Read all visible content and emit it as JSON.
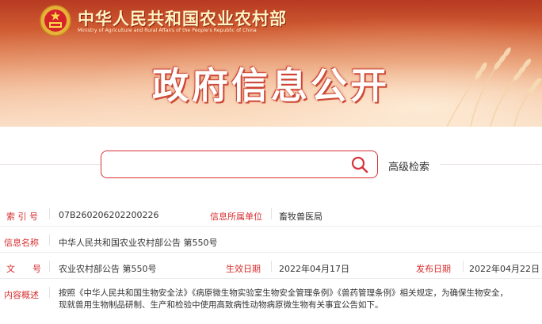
{
  "header": {
    "ministry_cn": "中华人民共和国农业农村部",
    "ministry_en": "Ministry of Agriculture and Rural Affairs of the People's Republic of China",
    "title": "政府信息公开"
  },
  "search": {
    "placeholder": "",
    "icon": "search-icon",
    "advanced_label": "高级检索"
  },
  "info": {
    "index_label": "索 引 号",
    "index_value": "07B260206202200226",
    "unit_label": "信息所属单位",
    "unit_value": "畜牧兽医局",
    "name_label": "信息名称",
    "name_value": "中华人民共和国农业农村部公告 第550号",
    "doc_label": "文　　号",
    "doc_value": "农业农村部公告 第550号",
    "effective_label": "生效日期",
    "effective_value": "2022年04月17日",
    "publish_label": "发布日期",
    "publish_value": "2022年04月22日",
    "summary_label": "内容概述",
    "summary_line1": "按照《中华人民共和国生物安全法》《病原微生物实验室生物安全管理条例》《兽药管理条例》相关规定，为确保生物安全，",
    "summary_line2": "现就兽用生物制品研制、生产和检验中使用高致病性动物病原微生物有关事宜公告如下。"
  },
  "colors": {
    "accent_red": "#d72d2d",
    "banner_red": "#c0392b"
  }
}
